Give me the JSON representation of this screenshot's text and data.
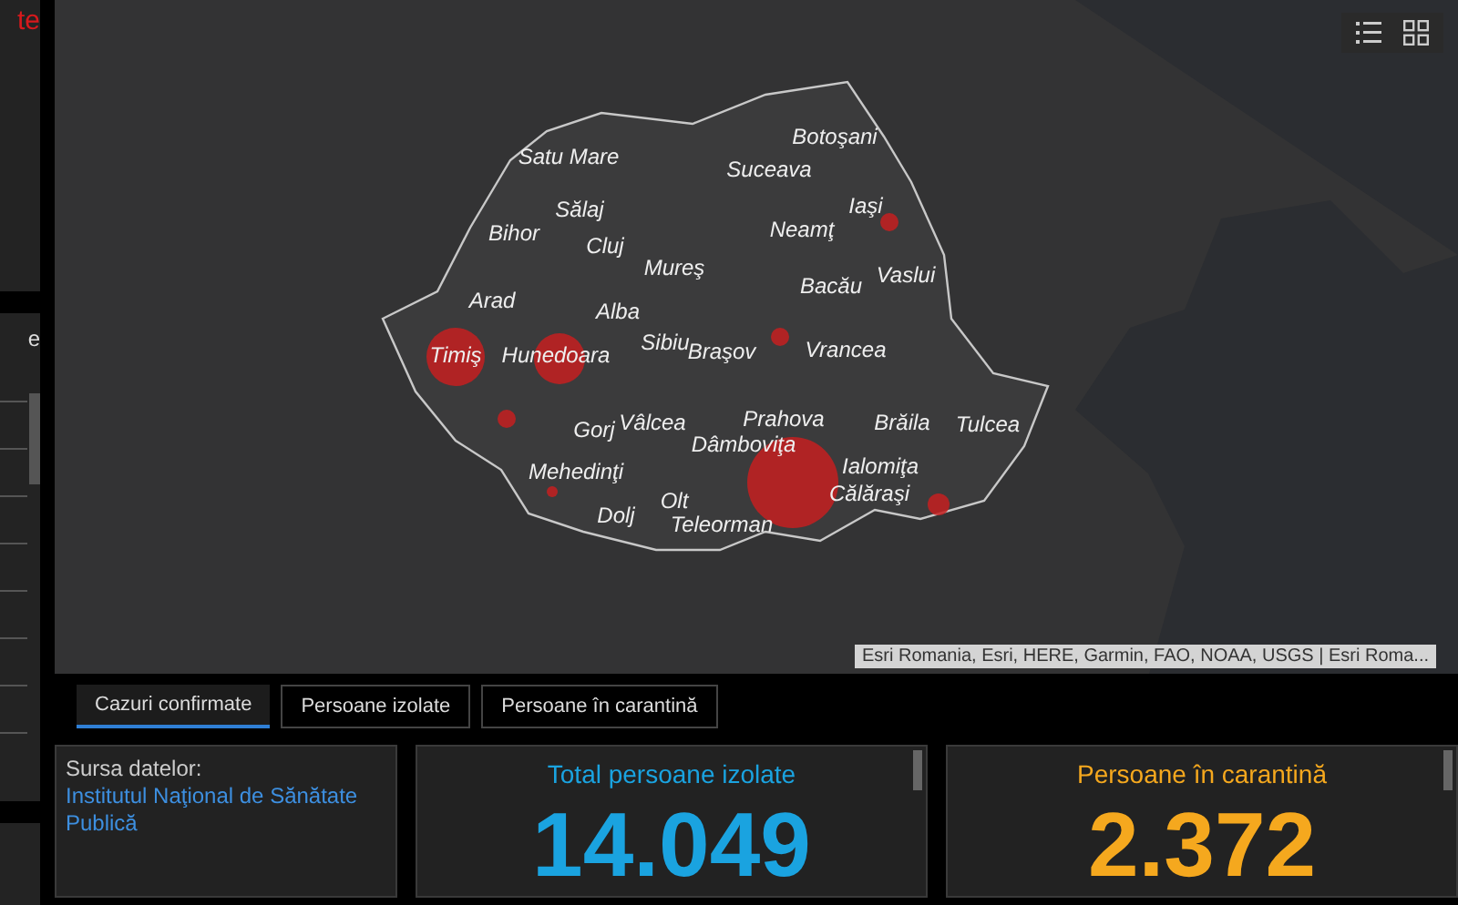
{
  "left_panels": [
    {
      "kind": "heading",
      "text": "te"
    },
    {
      "kind": "list",
      "text": "e"
    }
  ],
  "map": {
    "labels": [
      "Satu Mare",
      "Botoşani",
      "Suceava",
      "Sălaj",
      "Iaşi",
      "Bihor",
      "Cluj",
      "Neamţ",
      "Mureş",
      "Vaslui",
      "Bacău",
      "Arad",
      "Alba",
      "Timiş",
      "Hunedoara",
      "Sibiu",
      "Braşov",
      "Vrancea",
      "Gorj",
      "Vâlcea",
      "Prahova",
      "Brăila",
      "Tulcea",
      "Dâmboviţa",
      "Mehedinţi",
      "Ialomiţa",
      "Olt",
      "Călăraşi",
      "Dolj",
      "Teleorman"
    ],
    "attribution": "Esri Romania, Esri, HERE, Garmin, FAO, NOAA, USGS | Esri Roma..."
  },
  "tabs": [
    {
      "label": "Cazuri confirmate",
      "selected": true
    },
    {
      "label": "Persoane izolate",
      "selected": false
    },
    {
      "label": "Persoane în carantină",
      "selected": false
    }
  ],
  "source": {
    "prefix": "Sursa datelor:",
    "link": "Institutul Naţional de Sănătate Publică"
  },
  "stats": [
    {
      "title": "Total persoane izolate",
      "value": "14.049",
      "color": "#1aa3e0"
    },
    {
      "title": "Persoane în carantină",
      "value": "2.372",
      "color": "#f5a81e"
    }
  ]
}
